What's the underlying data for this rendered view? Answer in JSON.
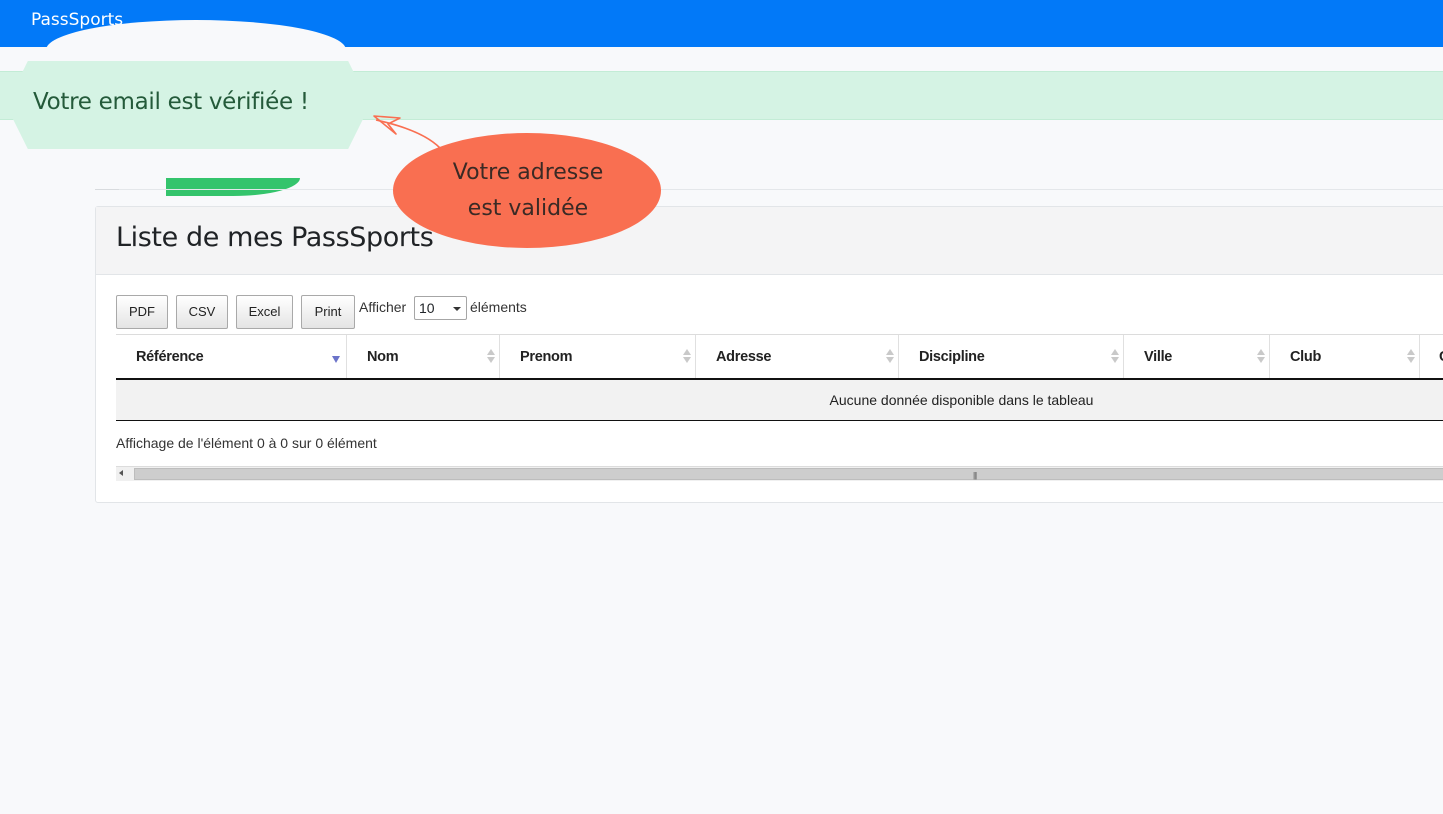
{
  "navbar": {
    "brand": "PassSports",
    "color": "#0279f8"
  },
  "alert": {
    "message": "Votre email est vérifiée !",
    "color": "#d5f3e4"
  },
  "callout": {
    "line1": "Votre adresse",
    "line2": "est validée",
    "color": "#f96f51"
  },
  "card": {
    "title": "Liste de mes PassSports"
  },
  "toolbar": {
    "buttons": [
      "PDF",
      "CSV",
      "Excel",
      "Print"
    ],
    "show_label": "Afficher",
    "page_length": "10",
    "elements_label": "éléments"
  },
  "table": {
    "columns": [
      "Référence",
      "Nom",
      "Prenom",
      "Adresse",
      "Discipline",
      "Ville",
      "Club",
      "C"
    ],
    "sorted_column": "Référence",
    "sort_icon": "sort-desc-icon",
    "empty_message": "Aucune donnée disponible dans le tableau"
  },
  "info": "Affichage de l'élément 0 à 0 sur 0 élément"
}
